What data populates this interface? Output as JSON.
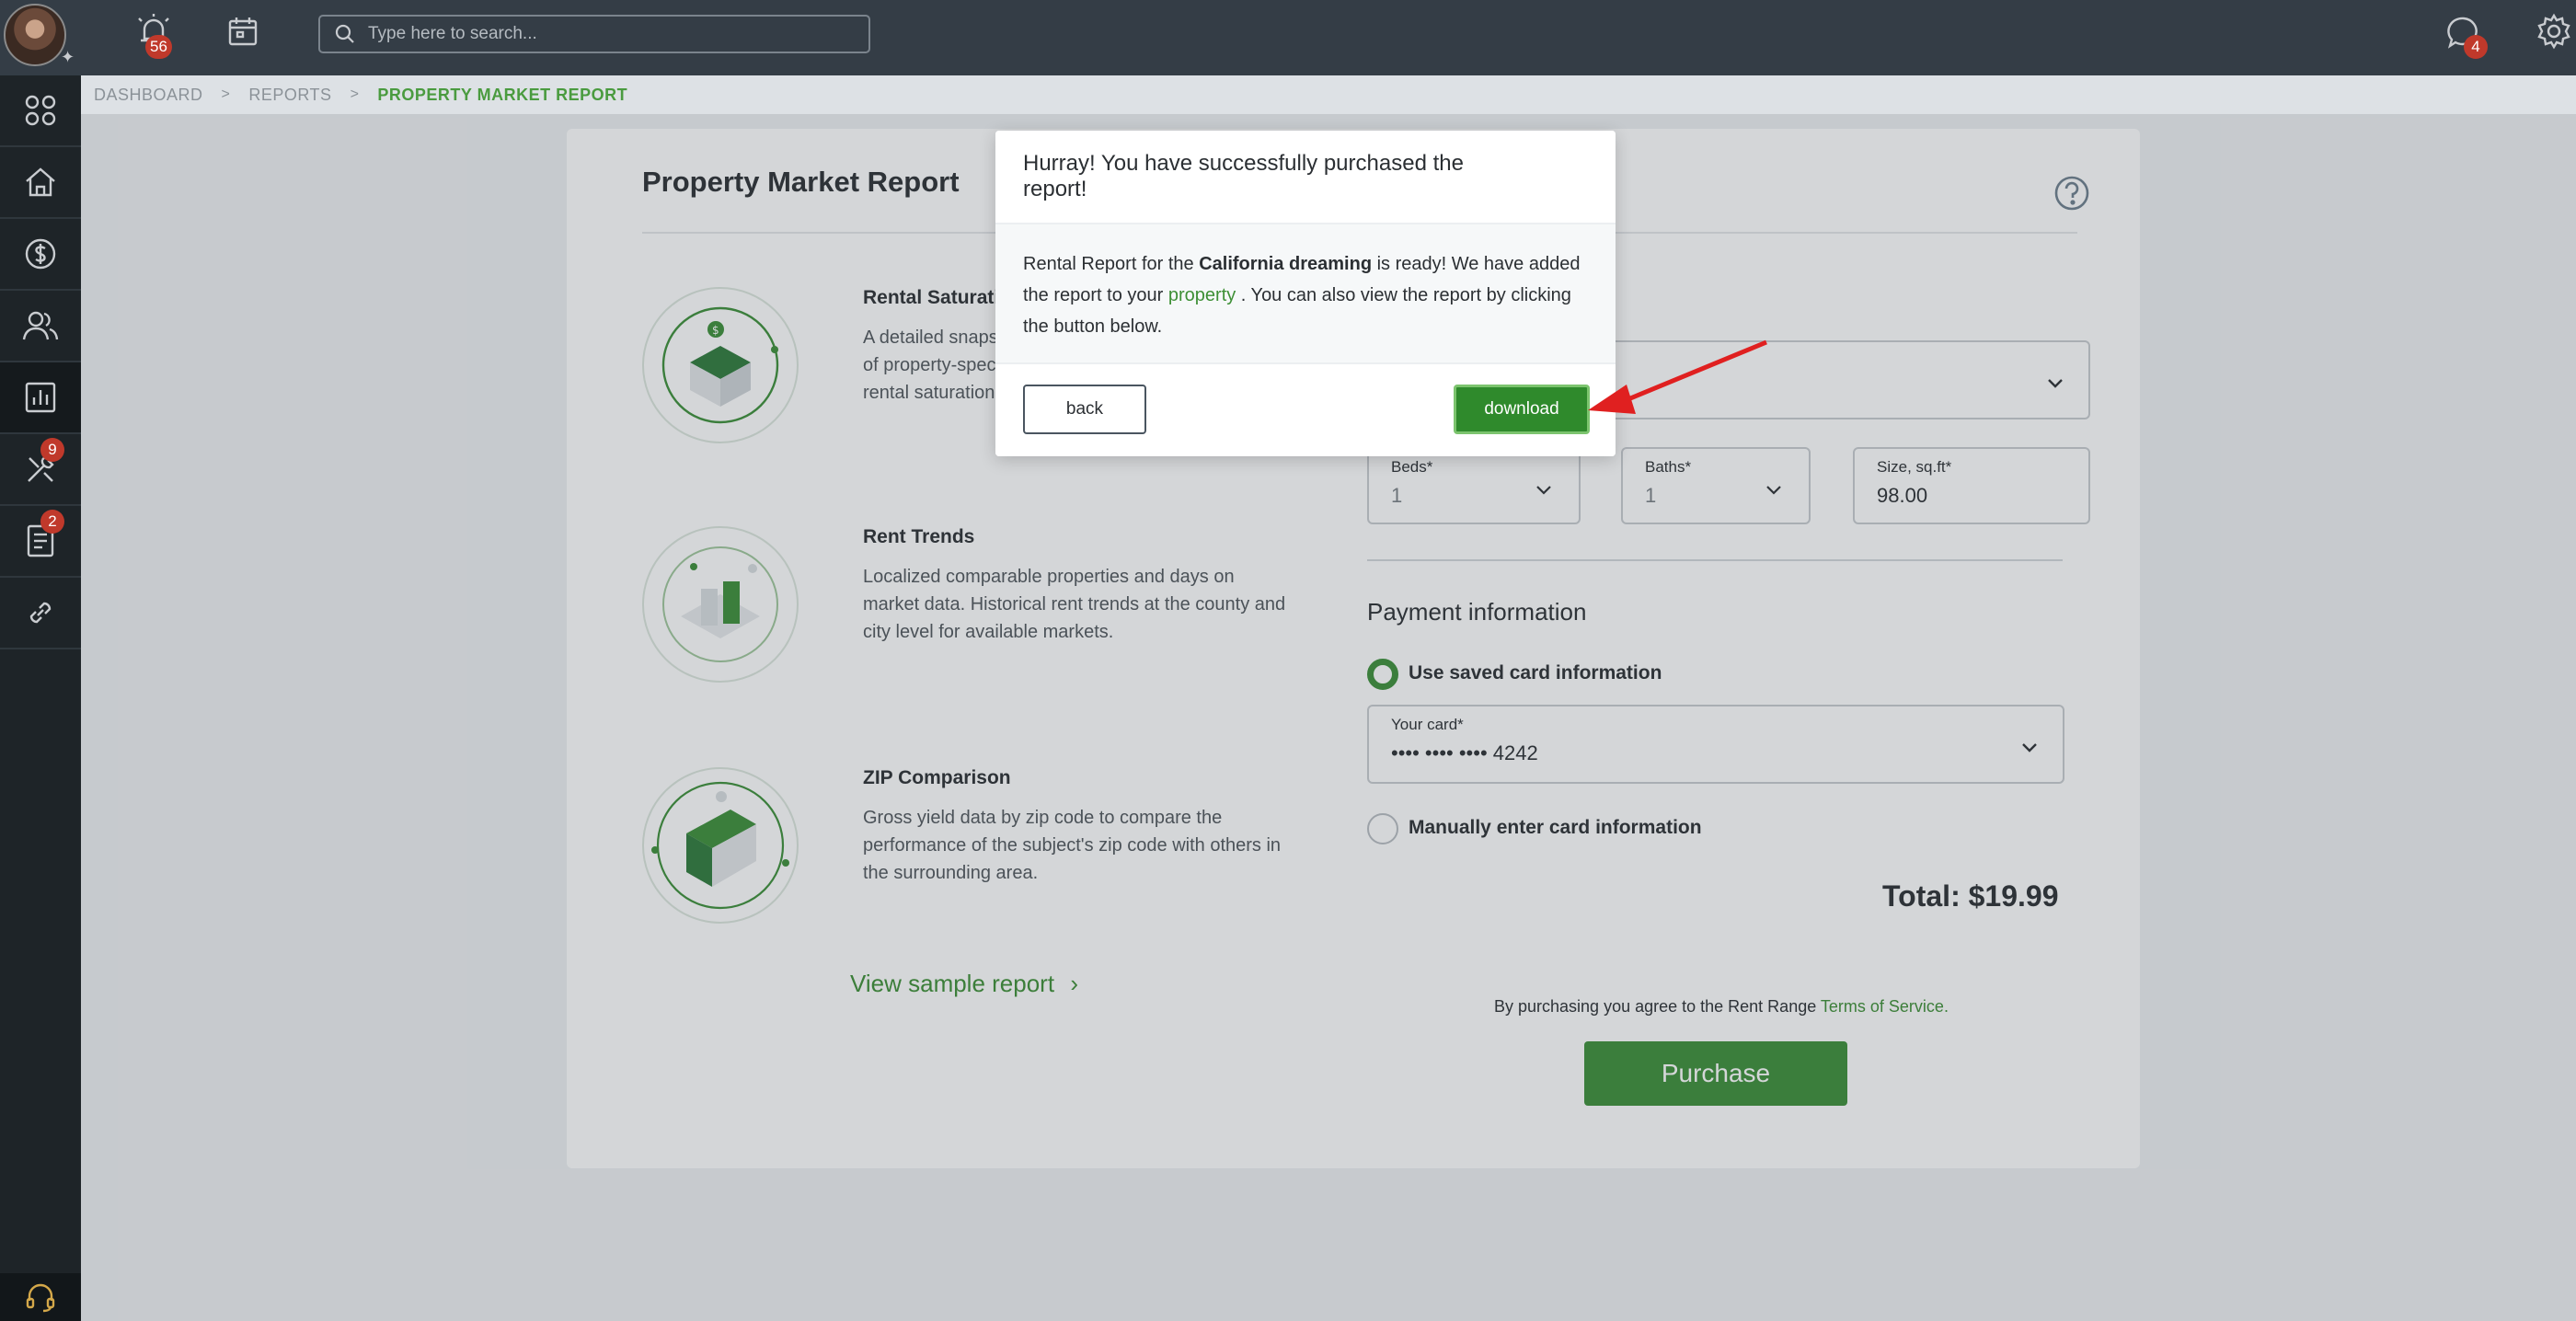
{
  "topbar": {
    "alerts_badge": "56",
    "search_placeholder": "Type here to search...",
    "messages_badge": "4"
  },
  "sidebar": {
    "tools_badge": "9",
    "docs_badge": "2"
  },
  "breadcrumb": {
    "items": [
      "DASHBOARD",
      "REPORTS"
    ],
    "current": "PROPERTY MARKET REPORT"
  },
  "report": {
    "title": "Property Market Report",
    "features": [
      {
        "title": "Rental Saturation",
        "description": "A detailed snapshot of property-specific rental saturation"
      },
      {
        "title": "Rent Trends",
        "description": "Localized comparable properties and days on market data. Historical rent trends at the county and city level for available markets."
      },
      {
        "title": "ZIP Comparison",
        "description": "Gross yield data by zip code to compare the performance of the subject's zip code with others in the surrounding area."
      }
    ],
    "sample_link": "View sample report"
  },
  "form": {
    "beds_label": "Beds*",
    "beds_value": "1",
    "baths_label": "Baths*",
    "baths_value": "1",
    "size_label": "Size, sq.ft*",
    "size_value": "98.00",
    "payment_title": "Payment information",
    "saved_card_label": "Use saved card information",
    "card_label": "Your card*",
    "card_value": "•••• •••• •••• 4242",
    "manual_card_label": "Manually enter card information",
    "total": "Total: $19.99",
    "terms_prefix": "By purchasing you agree to the Rent Range ",
    "terms_link": "Terms of Service.",
    "purchase_label": "Purchase"
  },
  "modal": {
    "title": "Hurray! You have successfully purchased the report!",
    "text_1": "Rental Report for the ",
    "property_name": "California dreaming",
    "text_2": " is ready! We have added the report to your ",
    "property_link": "property",
    "text_3": " . You can also view the report by clicking the button below.",
    "back_label": "back",
    "download_label": "download"
  },
  "colors": {
    "accent": "#3b8f38",
    "topbar": "#343d46",
    "sidebar": "#1e2428",
    "badge": "#c0392b",
    "arrow": "#e02020"
  }
}
